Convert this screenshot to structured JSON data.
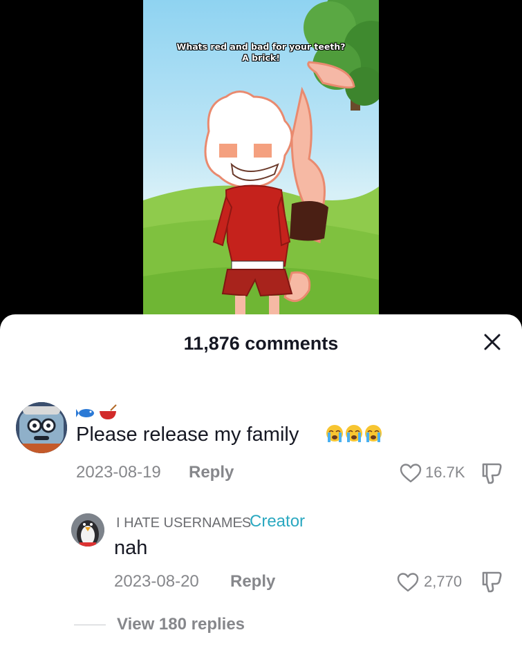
{
  "video": {
    "caption_line1": "Whats red and bad for your teeth?",
    "caption_line2": "A brick!"
  },
  "comments_panel": {
    "count_label": "11,876 comments",
    "close_icon": "close-icon"
  },
  "comment": {
    "username_icons": [
      "fish-emoji-icon",
      "soup-bowl-emoji-icon"
    ],
    "text": "Please release my family",
    "trailing_icons": [
      "loudly-crying-face-icon",
      "loudly-crying-face-icon",
      "loudly-crying-face-icon"
    ],
    "date": "2023-08-19",
    "reply_label": "Reply",
    "likes": "16.7K"
  },
  "reply": {
    "username": "I HATE USERNAMES",
    "separator": "·",
    "badge": "Creator",
    "text": "nah",
    "date": "2023-08-20",
    "reply_label": "Reply",
    "likes": "2,770"
  },
  "view_replies_label": "View 180 replies",
  "colors": {
    "background": "#000000",
    "sheet": "#ffffff",
    "primary_text": "#161823",
    "secondary_text": "#86878b",
    "creator_badge": "#2aa8c0"
  }
}
